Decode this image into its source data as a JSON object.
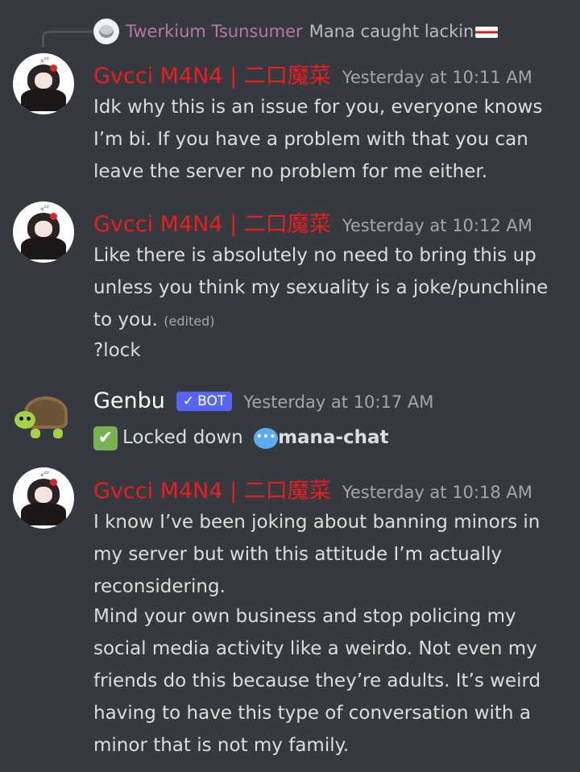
{
  "reply": {
    "username": "Twerkium Tsunsumer",
    "text": "Mana caught lackin"
  },
  "messages": [
    {
      "username": "Gvcci M4N4 | 二口魔菜",
      "timestamp": "Yesterday at 10:11 AM",
      "lines": [
        "Idk why this is an issue for you, everyone knows",
        "I’m bi. If you have a problem with that you can",
        "leave the server no problem for me either."
      ]
    },
    {
      "username": "Gvcci M4N4 | 二口魔菜",
      "timestamp": "Yesterday at 10:12 AM",
      "lines": [
        "Like there is absolutely no need to bring this up",
        "unless you think my sexuality is a joke/punchline",
        "to you."
      ],
      "edited": "(edited)",
      "followup": "?lock"
    },
    {
      "username": "Genbu",
      "bot_tag": "BOT",
      "timestamp": "Yesterday at 10:17 AM",
      "text": "Locked down",
      "channel": "mana-chat"
    },
    {
      "username": "Gvcci M4N4 | 二口魔菜",
      "timestamp": "Yesterday at 10:18 AM",
      "lines": [
        "I know I’ve been joking about banning minors in",
        "my server but with this attitude I’m actually",
        "reconsidering.",
        "Mind your own business and stop policing my",
        "social media activity like a weirdo. Not even my",
        "friends do this because they’re adults. It’s weird",
        "having to have this type of conversation with a",
        "minor that is not my family."
      ]
    }
  ],
  "colors": {
    "background": "#36393f",
    "username_red": "#e91e1e",
    "reply_name": "#b57aa3",
    "bot_tag": "#5865f2",
    "timestamp": "#a3a6aa"
  }
}
